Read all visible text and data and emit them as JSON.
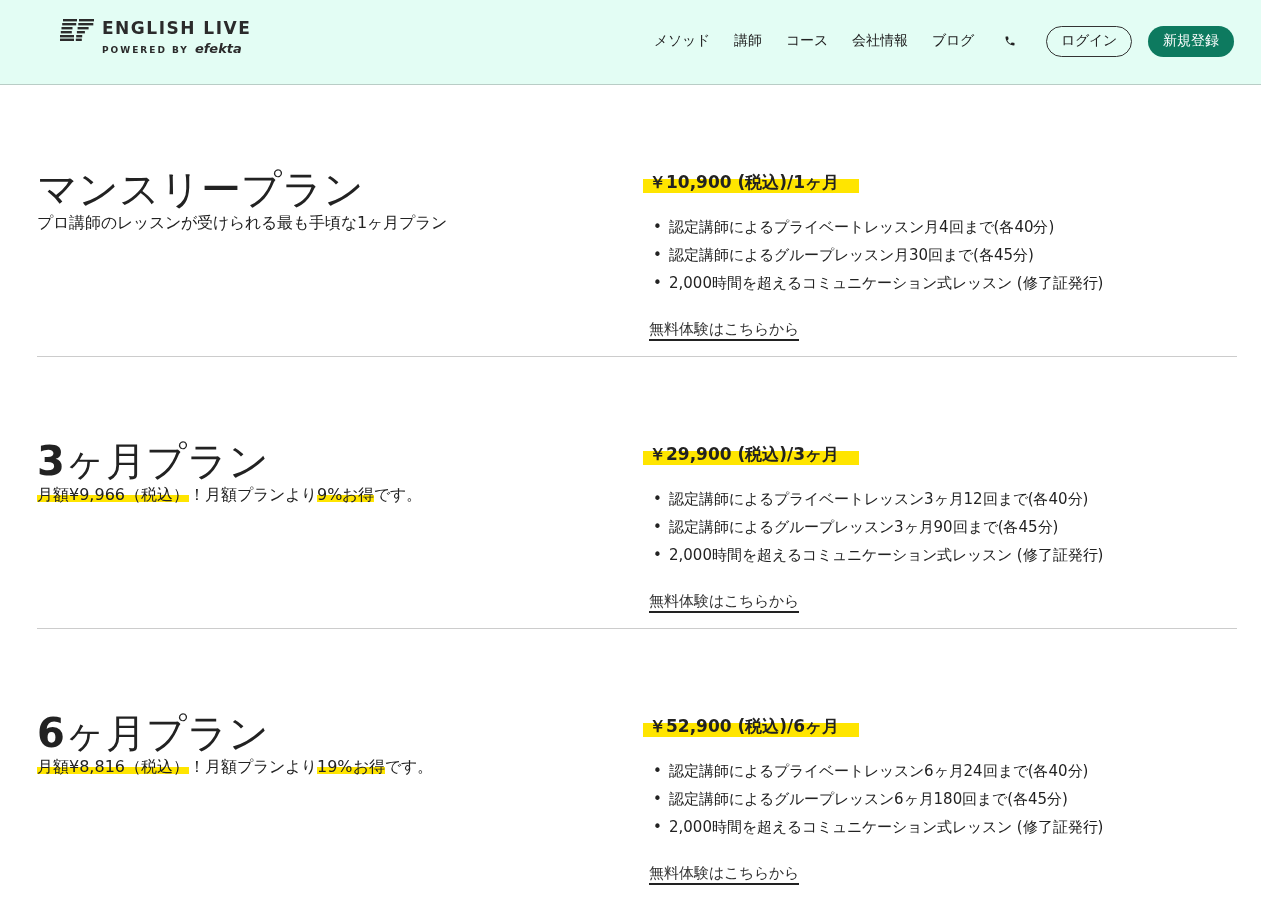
{
  "header": {
    "logo": {
      "title": "ENGLISH LIVE",
      "powered_by": "POWERED BY",
      "brand": "efekta"
    },
    "nav": [
      "メソッド",
      "講師",
      "コース",
      "会社情報",
      "ブログ"
    ],
    "login": "ログイン",
    "signup": "新規登録"
  },
  "plans": [
    {
      "title": "マンスリープラン",
      "subtitle": [
        {
          "text": "プロ講師のレッスンが受けられる最も手頃な1ヶ月プラン",
          "highlight": false
        }
      ],
      "price": "￥10,900 (税込)/1ヶ月",
      "features": [
        {
          "bullet": "•",
          "text": "認定講師によるプライベートレッスン月4回まで(各40分)"
        },
        {
          "bullet": "•",
          "text": "認定講師によるグループレッスン月30回まで(各45分)"
        },
        {
          "bullet": "•",
          "text": "2,000時間を超えるコミュニケーション式レッスン (修了証発行)"
        }
      ],
      "link": "無料体験はこちらから"
    },
    {
      "title": "**3**ヶ月プラン",
      "subtitle": [
        {
          "text": "月額¥9,966（税込）",
          "highlight": true
        },
        {
          "text": "！月額プランより",
          "highlight": false
        },
        {
          "text": "9%お得",
          "highlight": true
        },
        {
          "text": "です。",
          "highlight": false
        }
      ],
      "price": "￥29,900 (税込)/3ヶ月",
      "features": [
        {
          "bullet": "•",
          "text": "認定講師によるプライベートレッスン3ヶ月12回まで(各40分)"
        },
        {
          "bullet": "•",
          "text": "認定講師によるグループレッスン3ヶ月90回まで(各45分)"
        },
        {
          "bullet": "•",
          "text": "2,000時間を超えるコミュニケーション式レッスン (修了証発行)"
        }
      ],
      "link": "無料体験はこちらから"
    },
    {
      "title": "**6**ヶ月プラン",
      "subtitle": [
        {
          "text": "月額¥8,816（税込）",
          "highlight": true
        },
        {
          "text": "！月額プランより",
          "highlight": false
        },
        {
          "text": "19%お得",
          "highlight": true
        },
        {
          "text": "です。",
          "highlight": false
        }
      ],
      "price": "￥52,900 (税込)/6ヶ月",
      "features": [
        {
          "bullet": "•",
          "text": "認定講師によるプライベートレッスン6ヶ月24回まで(各40分)"
        },
        {
          "bullet": "•",
          "text": "認定講師によるグループレッスン6ヶ月180回まで(各45分)"
        },
        {
          "bullet": "•",
          "text": "2,000時間を超えるコミュニケーション式レッスン (修了証発行)"
        }
      ],
      "link": "無料体験はこちらから"
    }
  ]
}
